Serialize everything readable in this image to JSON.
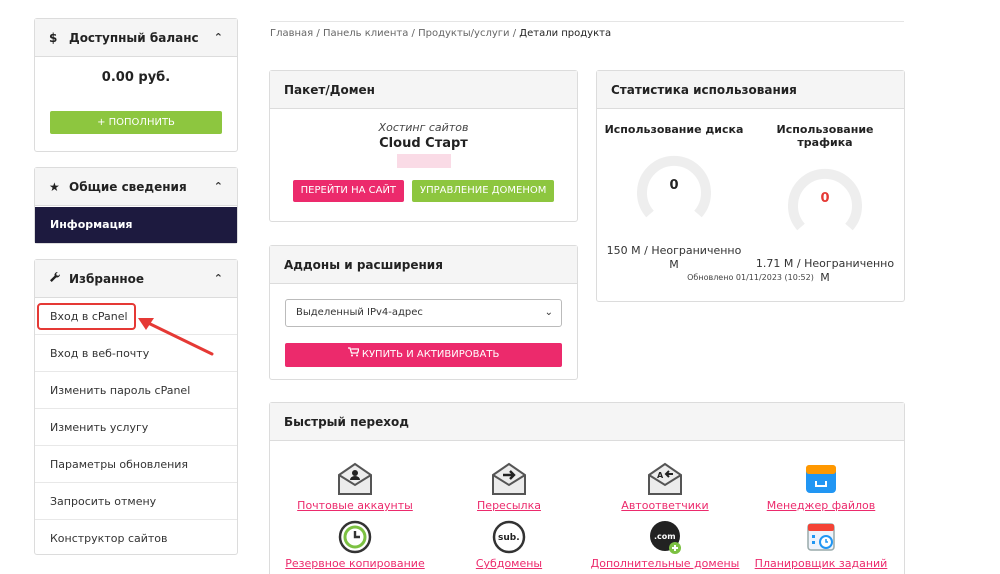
{
  "sidebar": {
    "balance": {
      "title": "Доступный баланс",
      "amount": "0.00 руб.",
      "topup_label": "ПОПОЛНИТЬ"
    },
    "overview": {
      "title": "Общие сведения",
      "selected_item": "Информация"
    },
    "favorites": {
      "title": "Избранное",
      "items": [
        "Вход в cPanel",
        "Вход в веб-почту",
        "Изменить пароль cPanel",
        "Изменить услугу",
        "Параметры обновления",
        "Запросить отмену",
        "Конструктор сайтов"
      ]
    }
  },
  "breadcrumb": {
    "items": [
      "Главная",
      "Панель клиента",
      "Продукты/услуги"
    ],
    "current": "Детали продукта",
    "separator": "/"
  },
  "package": {
    "title": "Пакет/Домен",
    "type": "Хостинг сайтов",
    "name": "Cloud Старт",
    "go_to_site": "ПЕРЕЙТИ НА САЙТ",
    "manage_domain": "УПРАВЛЕНИЕ ДОМЕНОМ"
  },
  "addons": {
    "title": "Аддоны и расширения",
    "selected": "Выделенный IPv4-адрес",
    "buy_label": "КУПИТЬ И АКТИВИРОВАТЬ"
  },
  "stats": {
    "title": "Статистика использования",
    "disk": {
      "title": "Использование диска",
      "value": "0",
      "usage_line1": "150 M / Неограниченно",
      "usage_line2": "M"
    },
    "traffic": {
      "title": "Использование трафика",
      "value": "0",
      "usage_line1": "1.71 M / Неограниченно",
      "usage_line2": "M"
    },
    "updated": "Обновлено 01/11/2023 (10:52)"
  },
  "quick": {
    "title": "Быстрый переход",
    "items": [
      {
        "label": "Почтовые аккаунты",
        "icon": "email-accounts-icon"
      },
      {
        "label": "Пересылка",
        "icon": "forwarders-icon"
      },
      {
        "label": "Автоответчики",
        "icon": "autoresponders-icon"
      },
      {
        "label": "Менеджер файлов",
        "icon": "file-manager-icon"
      },
      {
        "label": "Резервное копирование",
        "icon": "backup-icon"
      },
      {
        "label": "Субдомены",
        "icon": "subdomains-icon"
      },
      {
        "label": "Дополнительные домены",
        "icon": "addon-domains-icon"
      },
      {
        "label": "Планировщик заданий",
        "icon": "cron-jobs-icon"
      }
    ]
  },
  "colors": {
    "accent_pink": "#ec2a6c",
    "accent_green": "#8dc63f",
    "nav_selected": "#1d1a3f",
    "highlight_red": "#e53935"
  }
}
